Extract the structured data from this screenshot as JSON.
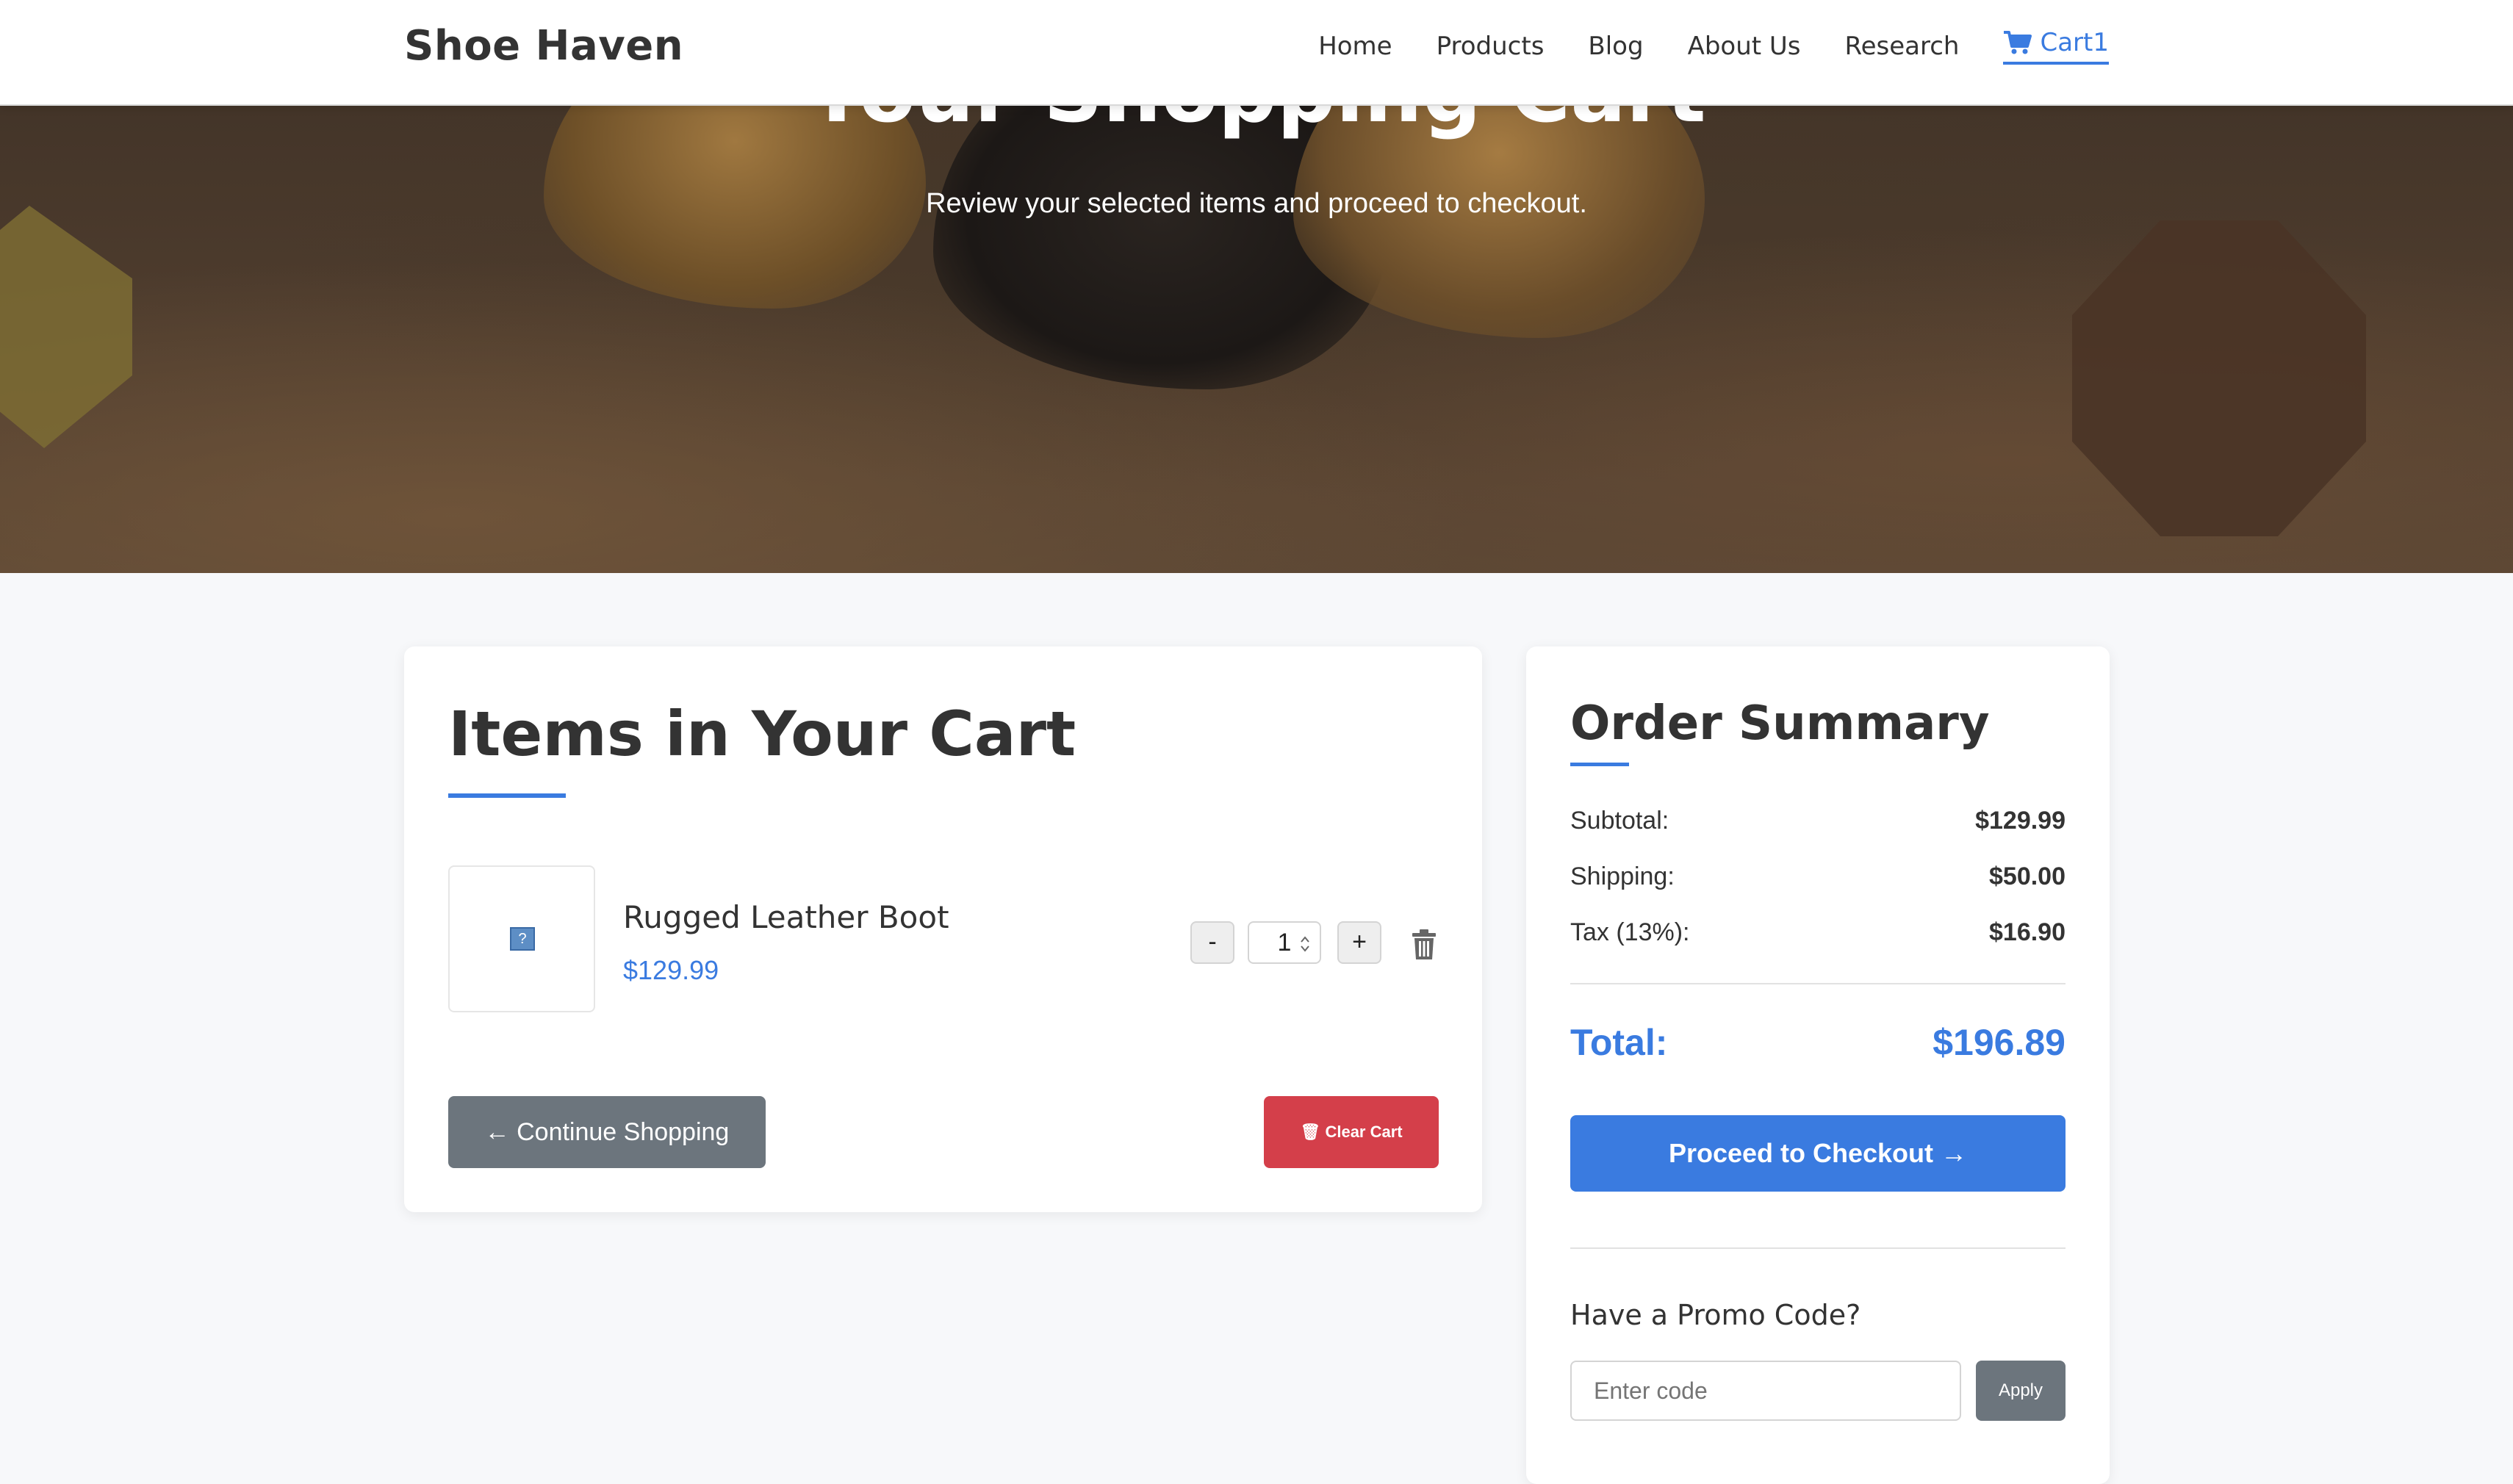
{
  "nav": {
    "brand": "Shoe Haven",
    "links": [
      "Home",
      "Products",
      "Blog",
      "About Us",
      "Research"
    ],
    "cart_label": "Cart",
    "cart_count": "1"
  },
  "hero": {
    "title": "Your Shopping Cart",
    "subtitle": "Review your selected items and proceed to checkout."
  },
  "cart": {
    "heading": "Items in Your Cart",
    "items": [
      {
        "name": "Rugged Leather Boot",
        "price": "$129.99",
        "quantity": "1"
      }
    ],
    "minus_label": "-",
    "plus_label": "+",
    "continue_label": "Continue Shopping",
    "clear_label": "Clear Cart"
  },
  "summary": {
    "heading": "Order Summary",
    "subtotal_label": "Subtotal:",
    "subtotal_value": "$129.99",
    "shipping_label": "Shipping:",
    "shipping_value": "$50.00",
    "tax_label": "Tax (13%):",
    "tax_value": "$16.90",
    "total_label": "Total:",
    "total_value": "$196.89",
    "checkout_label": "Proceed to Checkout",
    "promo_heading": "Have a Promo Code?",
    "promo_placeholder": "Enter code",
    "apply_label": "Apply"
  },
  "icons": {
    "cart": "shopping-cart-icon",
    "trash": "trash-icon",
    "arrow_left": "arrow-left-icon",
    "arrow_right": "arrow-right-icon"
  },
  "colors": {
    "accent": "#3a7be0",
    "danger": "#d43f4a",
    "secondary": "#6c757d"
  }
}
